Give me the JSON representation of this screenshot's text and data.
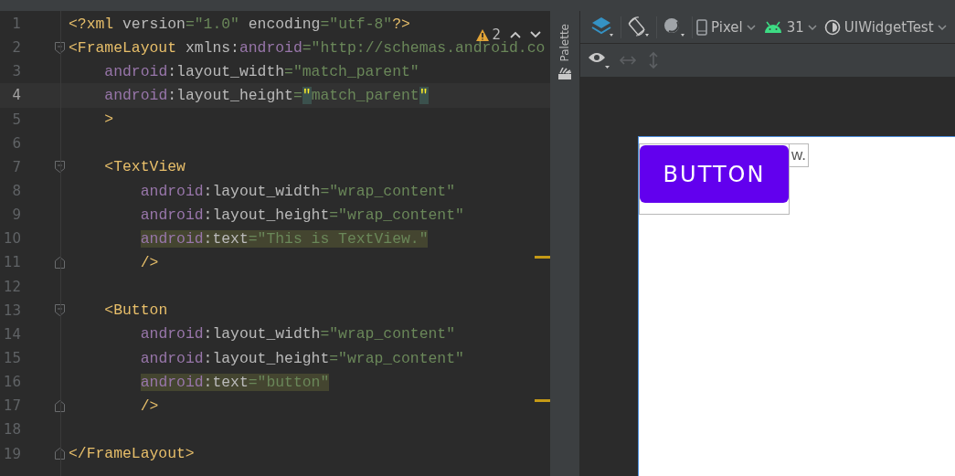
{
  "editor": {
    "warnings": {
      "count": "2"
    },
    "lines": [
      {
        "number": "1",
        "kind": "plain",
        "current": false,
        "segments": [
          {
            "kind": "tag",
            "text": "<?xml",
            "highlighted": false
          },
          {
            "kind": "attr",
            "text": " version",
            "highlighted": false
          },
          {
            "kind": "value",
            "text": "=\"1.0\"",
            "highlighted": false
          },
          {
            "kind": "attr",
            "text": " encoding",
            "highlighted": false
          },
          {
            "kind": "value",
            "text": "=\"utf-8\"",
            "highlighted": false
          },
          {
            "kind": "tag",
            "text": "?>",
            "highlighted": false
          }
        ]
      },
      {
        "number": "2",
        "kind": "opener",
        "current": false,
        "segments": [
          {
            "kind": "tag",
            "text": "<FrameLayout",
            "highlighted": false
          },
          {
            "kind": "attr",
            "text": " xmlns:",
            "highlighted": false
          },
          {
            "kind": "ns",
            "text": "android",
            "highlighted": false
          },
          {
            "kind": "value",
            "text": "=\"http://schemas.android.co",
            "highlighted": false
          }
        ]
      },
      {
        "number": "3",
        "kind": "plain",
        "current": false,
        "segments": [
          {
            "kind": "ns",
            "text": "    android",
            "highlighted": false
          },
          {
            "kind": "attr",
            "text": ":layout_width",
            "highlighted": false
          },
          {
            "kind": "value",
            "text": "=\"match_parent\"",
            "highlighted": false
          }
        ]
      },
      {
        "number": "4",
        "kind": "plain",
        "current": true,
        "segments": [
          {
            "kind": "ns",
            "text": "    android",
            "highlighted": false
          },
          {
            "kind": "attr",
            "text": ":layout_height",
            "highlighted": false
          },
          {
            "kind": "value",
            "text": "=",
            "highlighted": false
          },
          {
            "kind": "brace",
            "text": "\"",
            "highlighted": true
          },
          {
            "kind": "value",
            "text": "match_parent",
            "highlighted": false
          },
          {
            "kind": "brace",
            "text": "\"",
            "highlighted": true
          }
        ]
      },
      {
        "number": "5",
        "kind": "plain",
        "current": false,
        "segments": [
          {
            "kind": "tag",
            "text": "    >",
            "highlighted": false
          }
        ]
      },
      {
        "number": "6",
        "kind": "plain",
        "current": false
      },
      {
        "number": "7",
        "kind": "opener",
        "current": false,
        "segments": [
          {
            "kind": "tag",
            "text": "    <TextView",
            "highlighted": false
          }
        ]
      },
      {
        "number": "8",
        "kind": "plain",
        "current": false,
        "segments": [
          {
            "kind": "ns",
            "text": "        android",
            "highlighted": false
          },
          {
            "kind": "attr",
            "text": ":layout_width",
            "highlighted": false
          },
          {
            "kind": "value",
            "text": "=\"wrap_content\"",
            "highlighted": false
          }
        ]
      },
      {
        "number": "9",
        "kind": "plain",
        "current": false,
        "segments": [
          {
            "kind": "ns",
            "text": "        android",
            "highlighted": false
          },
          {
            "kind": "attr",
            "text": ":layout_height",
            "highlighted": false
          },
          {
            "kind": "value",
            "text": "=\"wrap_content\"",
            "highlighted": false
          }
        ]
      },
      {
        "number": "10",
        "kind": "plain",
        "current": false,
        "segments": [
          {
            "kind": "ns",
            "text": "        android",
            "highlighted": true
          },
          {
            "kind": "attr",
            "text": ":text",
            "highlighted": true
          },
          {
            "kind": "value",
            "text": "=\"This is TextView.\"",
            "highlighted": true
          }
        ]
      },
      {
        "number": "11",
        "kind": "closer",
        "current": false,
        "segments": [
          {
            "kind": "tag",
            "text": "        />",
            "highlighted": false
          }
        ]
      },
      {
        "number": "12",
        "kind": "plain",
        "current": false
      },
      {
        "number": "13",
        "kind": "opener",
        "current": false,
        "segments": [
          {
            "kind": "tag",
            "text": "    <Button",
            "highlighted": false
          }
        ]
      },
      {
        "number": "14",
        "kind": "plain",
        "current": false,
        "segments": [
          {
            "kind": "ns",
            "text": "        android",
            "highlighted": false
          },
          {
            "kind": "attr",
            "text": ":layout_width",
            "highlighted": false
          },
          {
            "kind": "value",
            "text": "=\"wrap_content\"",
            "highlighted": false
          }
        ]
      },
      {
        "number": "15",
        "kind": "plain",
        "current": false,
        "segments": [
          {
            "kind": "ns",
            "text": "        android",
            "highlighted": false
          },
          {
            "kind": "attr",
            "text": ":layout_height",
            "highlighted": false
          },
          {
            "kind": "value",
            "text": "=\"wrap_content\"",
            "highlighted": false
          }
        ]
      },
      {
        "number": "16",
        "kind": "plain",
        "current": false,
        "segments": [
          {
            "kind": "ns",
            "text": "        android",
            "highlighted": true
          },
          {
            "kind": "attr",
            "text": ":text",
            "highlighted": true
          },
          {
            "kind": "value",
            "text": "=\"button\"",
            "highlighted": true
          }
        ]
      },
      {
        "number": "17",
        "kind": "closer",
        "current": false,
        "segments": [
          {
            "kind": "tag",
            "text": "        />",
            "highlighted": false
          }
        ]
      },
      {
        "number": "18",
        "kind": "plain",
        "current": false
      },
      {
        "number": "19",
        "kind": "closer",
        "current": false,
        "segments": [
          {
            "kind": "tag",
            "text": "</FrameLayout>",
            "highlighted": false
          }
        ]
      }
    ]
  },
  "palette": {
    "label": "Palette"
  },
  "toolbar": {
    "device": "Pixel",
    "api": "31",
    "theme": "UIWidgetTest"
  },
  "preview": {
    "text_view": {
      "text": "w."
    },
    "button": {
      "text": "BUTTON"
    }
  }
}
